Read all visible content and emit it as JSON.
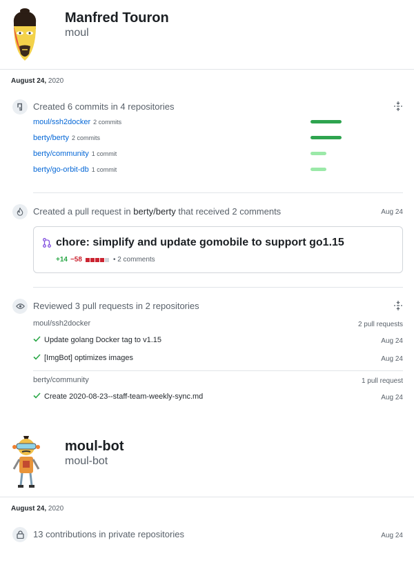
{
  "user1": {
    "name": "Manfred Touron",
    "login": "moul",
    "date_month": "August 24,",
    "date_year": "2020",
    "commits": {
      "title": "Created 6 commits in 4 repositories",
      "rows": [
        {
          "repo": "moul/ssh2docker",
          "count": "2 commits",
          "fraction": 1.0
        },
        {
          "repo": "berty/berty",
          "count": "2 commits",
          "fraction": 1.0
        },
        {
          "repo": "berty/community",
          "count": "1 commit",
          "fraction": 0.5
        },
        {
          "repo": "berty/go-orbit-db",
          "count": "1 commit",
          "fraction": 0.5
        }
      ]
    },
    "pull_request": {
      "title_prefix": "Created a pull request in",
      "repo": "berty/berty",
      "title_suffix": "that received 2 comments",
      "date": "Aug 24",
      "pr_title": "chore: simplify and update gomobile to support go1.15",
      "additions": "+14",
      "deletions": "−58",
      "comments": "• 2 comments"
    },
    "reviews": {
      "title": "Reviewed 3 pull requests in 2 repositories",
      "groups": [
        {
          "repo": "moul/ssh2docker",
          "count": "2 pull requests",
          "items": [
            {
              "title": "Update golang Docker tag to v1.15",
              "date": "Aug 24"
            },
            {
              "title": "[ImgBot] optimizes images",
              "date": "Aug 24"
            }
          ]
        },
        {
          "repo": "berty/community",
          "count": "1 pull request",
          "items": [
            {
              "title": "Create 2020-08-23--staff-team-weekly-sync.md",
              "date": "Aug 24"
            }
          ]
        }
      ]
    }
  },
  "user2": {
    "name": "moul-bot",
    "login": "moul-bot",
    "date_month": "August 24,",
    "date_year": "2020",
    "private": {
      "title": "13 contributions in private repositories",
      "date": "Aug 24"
    }
  },
  "colors": {
    "link": "#0366d6",
    "bar_strong": "#2ea44f",
    "bar_light": "#9be9a8",
    "addition": "#28a745",
    "deletion": "#cb2431",
    "pr_icon": "#8250df"
  }
}
